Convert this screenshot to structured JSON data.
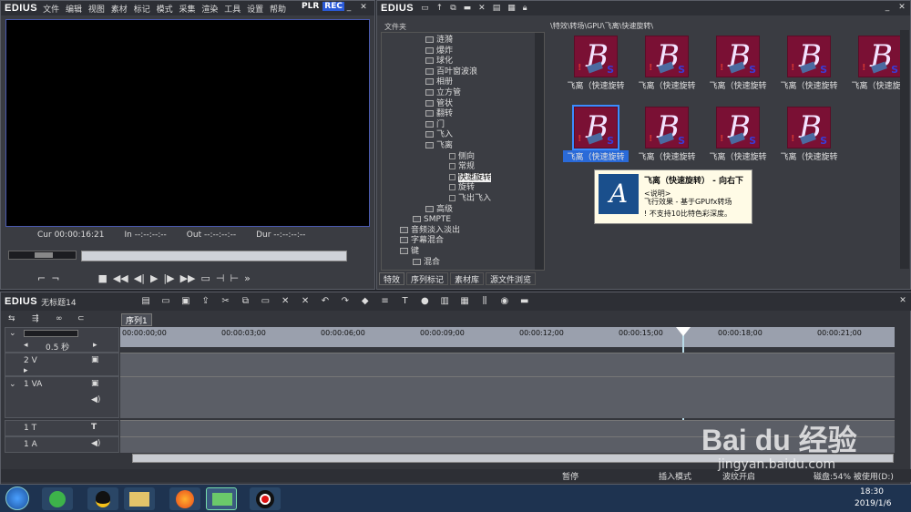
{
  "player": {
    "logo": "EDIUS",
    "menu": [
      "文件",
      "编辑",
      "视图",
      "素材",
      "标记",
      "模式",
      "采集",
      "渲染",
      "工具",
      "设置",
      "帮助"
    ],
    "plr": "PLR",
    "rec": "REC",
    "cur_label": "Cur",
    "cur_value": "00:00:16:21",
    "in_label": "In",
    "in_value": "--:--:--:--",
    "out_label": "Out",
    "out_value": "--:--:--:--",
    "dur_label": "Dur",
    "dur_value": "--:--:--:--"
  },
  "bin": {
    "logo": "EDIUS",
    "folder_header": "文件夹",
    "path": "\\特效\\转场\\GPU\\飞离\\快速旋转\\",
    "tree": [
      {
        "label": "涟漪",
        "level": 2
      },
      {
        "label": "爆炸",
        "level": 2
      },
      {
        "label": "球化",
        "level": 2
      },
      {
        "label": "百叶窗波浪",
        "level": 2
      },
      {
        "label": "相册",
        "level": 2
      },
      {
        "label": "立方管",
        "level": 2
      },
      {
        "label": "管状",
        "level": 2
      },
      {
        "label": "翻转",
        "level": 2
      },
      {
        "label": "门",
        "level": 2
      },
      {
        "label": "飞入",
        "level": 2
      },
      {
        "label": "飞离",
        "level": 2
      },
      {
        "label": "侧向",
        "level": 3
      },
      {
        "label": "常规",
        "level": 3
      },
      {
        "label": "快速旋转",
        "level": 3,
        "selected": true
      },
      {
        "label": "旋转",
        "level": 3
      },
      {
        "label": "飞出飞入",
        "level": 3
      },
      {
        "label": "高级",
        "level": 2
      },
      {
        "label": "SMPTE",
        "level": 1
      },
      {
        "label": "音频淡入淡出",
        "level": 0
      },
      {
        "label": "字幕混合",
        "level": 0
      },
      {
        "label": "键",
        "level": 0
      },
      {
        "label": "混合",
        "level": 1
      }
    ],
    "tabs": [
      "特效",
      "序列标记",
      "素材库",
      "源文件浏览"
    ],
    "thumbnails": [
      "飞离（快速旋转",
      "飞离（快速旋转",
      "飞离（快速旋转",
      "飞离（快速旋转",
      "飞离（快速旋转",
      "飞离（快速旋转",
      "飞离（快速旋转",
      "飞离（快速旋转",
      "飞离（快速旋转"
    ],
    "tooltip": {
      "title": "飞离（快速旋转） - 向右下",
      "desc_label": "<说明>",
      "desc": "飞行效果 - 基于GPUfx转场",
      "warning": "不支持10比特色彩深度。",
      "icon_letter": "A"
    }
  },
  "timeline": {
    "logo": "EDIUS",
    "project": "无标题14",
    "sequence_tab": "序列1",
    "scale": "0.5 秒",
    "timecodes": [
      "00:00:00;00",
      "00:00:03;00",
      "00:00:06;00",
      "00:00:09;00",
      "00:00:12;00",
      "00:00:15;00",
      "00:00:18;00",
      "00:00:21;00"
    ],
    "tracks": [
      {
        "name": "2 V"
      },
      {
        "name": "1 VA"
      },
      {
        "name": "1 T"
      },
      {
        "name": "1 A"
      }
    ],
    "status": {
      "pause": "暂停",
      "insert": "插入模式",
      "ripple": "波纹开启",
      "disk": "磁盘:54% 被使用(D:)"
    }
  },
  "taskbar": {
    "time": "18:30",
    "date": "2019/1/6"
  },
  "watermark": {
    "brand": "Bai du 经验",
    "url": "jingyan.baidu.com"
  }
}
